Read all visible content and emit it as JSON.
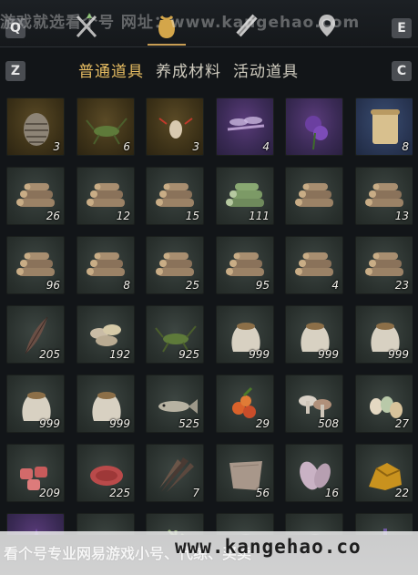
{
  "topbar": {
    "key_left": "Q",
    "key_right": "E",
    "tab_icons": [
      "crossed-swords-icon",
      "pouch-icon",
      "scroll-icon",
      "map-pin-icon"
    ],
    "active_tab_index": 1,
    "watermark": "游戏就选看个号  网址：www.kangehao.com"
  },
  "categories": {
    "key_left": "Z",
    "key_right": "C",
    "tabs": [
      "普通道具",
      "养成材料",
      "活动道具"
    ],
    "active_index": 0
  },
  "items": [
    {
      "name": "pinecone",
      "count": "3",
      "rarity": "gold"
    },
    {
      "name": "cricket",
      "count": "6",
      "rarity": "gold"
    },
    {
      "name": "firefly",
      "count": "3",
      "rarity": "gold"
    },
    {
      "name": "dragonfly",
      "count": "4",
      "rarity": "purple"
    },
    {
      "name": "purple-flower",
      "count": "",
      "rarity": "purple"
    },
    {
      "name": "scroll",
      "count": "8",
      "rarity": "blue"
    },
    {
      "name": "log-pile",
      "count": "26",
      "rarity": "normal"
    },
    {
      "name": "log-pile",
      "count": "12",
      "rarity": "normal"
    },
    {
      "name": "log-pile",
      "count": "15",
      "rarity": "normal"
    },
    {
      "name": "bamboo-logs",
      "count": "111",
      "rarity": "normal"
    },
    {
      "name": "log-pile",
      "count": "",
      "rarity": "normal"
    },
    {
      "name": "log-pile",
      "count": "13",
      "rarity": "normal"
    },
    {
      "name": "log-pile",
      "count": "96",
      "rarity": "normal"
    },
    {
      "name": "log-pile",
      "count": "8",
      "rarity": "normal"
    },
    {
      "name": "log-pile",
      "count": "25",
      "rarity": "normal"
    },
    {
      "name": "log-pile",
      "count": "95",
      "rarity": "normal"
    },
    {
      "name": "log-pile",
      "count": "4",
      "rarity": "normal"
    },
    {
      "name": "log-pile",
      "count": "23",
      "rarity": "normal"
    },
    {
      "name": "feather",
      "count": "205",
      "rarity": "normal"
    },
    {
      "name": "mushroom-slices",
      "count": "192",
      "rarity": "normal"
    },
    {
      "name": "cricket",
      "count": "925",
      "rarity": "normal"
    },
    {
      "name": "grain-sack",
      "count": "999",
      "rarity": "normal"
    },
    {
      "name": "grain-sack",
      "count": "999",
      "rarity": "normal"
    },
    {
      "name": "grain-sack",
      "count": "999",
      "rarity": "normal"
    },
    {
      "name": "grain-sack",
      "count": "999",
      "rarity": "normal"
    },
    {
      "name": "grain-sack",
      "count": "999",
      "rarity": "normal"
    },
    {
      "name": "fish",
      "count": "525",
      "rarity": "normal"
    },
    {
      "name": "berries",
      "count": "29",
      "rarity": "normal"
    },
    {
      "name": "mushrooms",
      "count": "508",
      "rarity": "normal"
    },
    {
      "name": "eggs",
      "count": "27",
      "rarity": "normal"
    },
    {
      "name": "meat-chunks",
      "count": "209",
      "rarity": "normal"
    },
    {
      "name": "steak",
      "count": "225",
      "rarity": "normal"
    },
    {
      "name": "feather-bundle",
      "count": "7",
      "rarity": "normal"
    },
    {
      "name": "hide",
      "count": "56",
      "rarity": "normal"
    },
    {
      "name": "drumsticks",
      "count": "16",
      "rarity": "normal"
    },
    {
      "name": "ore",
      "count": "22",
      "rarity": "normal"
    },
    {
      "name": "purple-crystal",
      "count": "",
      "rarity": "purple"
    },
    {
      "name": "bowl",
      "count": "",
      "rarity": "normal"
    },
    {
      "name": "herb",
      "count": "",
      "rarity": "normal"
    },
    {
      "name": "misc",
      "count": "",
      "rarity": "normal"
    },
    {
      "name": "misc",
      "count": "",
      "rarity": "normal"
    },
    {
      "name": "lavender",
      "count": "",
      "rarity": "normal"
    }
  ],
  "watermark_bottom": {
    "text": "看个号专业网易游戏小号、代练、买卖",
    "url": "www.kangehao.co"
  },
  "colors": {
    "accent_gold": "#e7bd62",
    "background": "#121518"
  }
}
